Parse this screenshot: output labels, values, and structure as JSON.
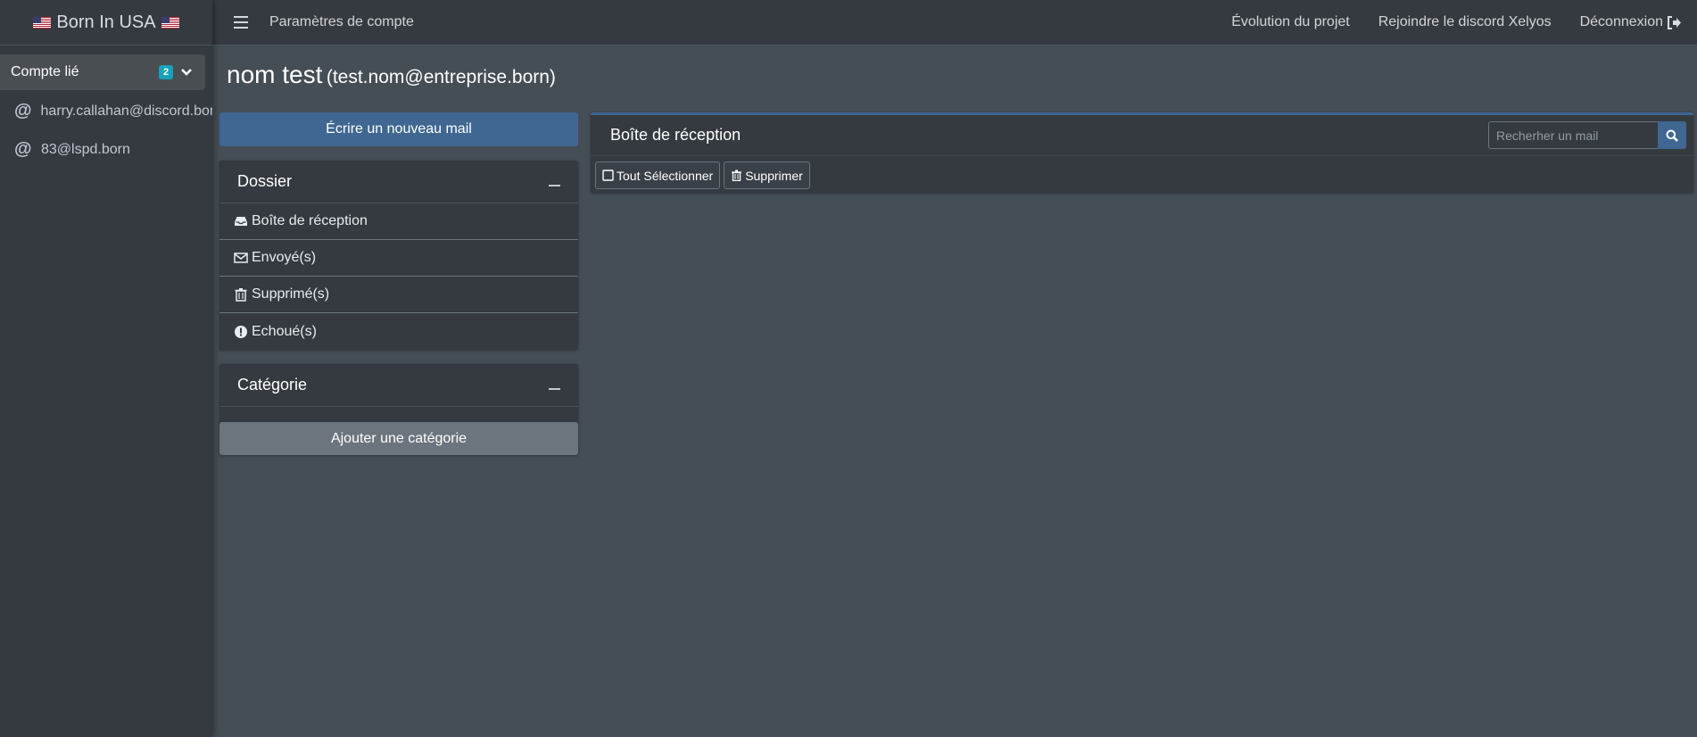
{
  "brand": {
    "title": "Born In USA"
  },
  "sidebar": {
    "linked_label": "Compte lié",
    "linked_count": "2",
    "accounts": [
      {
        "email": "harry.callahan@discord.born"
      },
      {
        "email": "83@lspd.born"
      }
    ]
  },
  "topnav": {
    "title": "Paramètres de compte",
    "links": [
      "Évolution du projet",
      "Rejoindre le discord Xelyos",
      "Déconnexion"
    ]
  },
  "user": {
    "name": "nom test",
    "email": "(test.nom@entreprise.born)"
  },
  "compose_label": "Écrire un nouveau mail",
  "folders": {
    "title": "Dossier",
    "items": [
      "Boîte de réception",
      "Envoyé(s)",
      "Supprimé(s)",
      "Echoué(s)"
    ]
  },
  "categories": {
    "title": "Catégorie",
    "add_label": "Ajouter une catégorie"
  },
  "inbox": {
    "title": "Boîte de réception",
    "search_placeholder": "Recherher un mail",
    "select_all_label": "Tout Sélectionner",
    "delete_label": "Supprimer"
  },
  "colors": {
    "primary": "#3f6791",
    "badge": "#17a2b8",
    "sidebar": "#343a40",
    "content": "#454d55"
  }
}
